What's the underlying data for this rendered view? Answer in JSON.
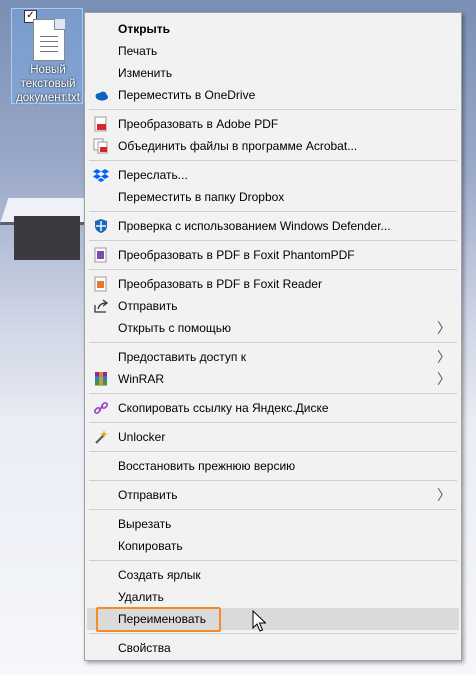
{
  "desktop": {
    "file_icon_label": "Новый текстовый документ.txt",
    "label_lines": [
      "Новый",
      "текстовый",
      "документ.txt"
    ]
  },
  "menu": {
    "items": [
      {
        "label": "Открыть",
        "bold": true
      },
      {
        "label": "Печать"
      },
      {
        "label": "Изменить"
      },
      {
        "label": "Переместить в OneDrive",
        "icon": "onedrive-icon"
      },
      {
        "label": "Преобразовать в Adobe PDF",
        "icon": "adobe-pdf-icon"
      },
      {
        "label": "Объединить файлы в программе Acrobat...",
        "icon": "acrobat-combine-icon"
      },
      {
        "label": "Переслать...",
        "icon": "dropbox-icon"
      },
      {
        "label": "Переместить в папку Dropbox"
      },
      {
        "label": "Проверка с использованием Windows Defender...",
        "icon": "windows-defender-icon"
      },
      {
        "label": "Преобразовать в PDF в Foxit PhantomPDF",
        "icon": "foxit-phantompdf-icon"
      },
      {
        "label": "Преобразовать в PDF в Foxit Reader",
        "icon": "foxit-reader-icon"
      },
      {
        "label": "Отправить",
        "icon": "share-icon"
      },
      {
        "label": "Открыть с помощью",
        "submenu": true
      },
      {
        "label": "Предоставить доступ к",
        "submenu": true
      },
      {
        "label": "WinRAR",
        "icon": "winrar-icon",
        "submenu": true
      },
      {
        "label": "Скопировать ссылку на Яндекс.Диске",
        "icon": "yandex-link-icon"
      },
      {
        "label": "Unlocker",
        "icon": "unlocker-wand-icon"
      },
      {
        "label": "Восстановить прежнюю версию"
      },
      {
        "label": "Отправить",
        "submenu": true
      },
      {
        "label": "Вырезать"
      },
      {
        "label": "Копировать"
      },
      {
        "label": "Создать ярлык"
      },
      {
        "label": "Удалить"
      },
      {
        "label": "Переименовать",
        "hovered": true
      },
      {
        "label": "Свойства"
      }
    ]
  },
  "colors": {
    "highlight_outline": "#f28c28",
    "menu_bg": "#f2f2f2",
    "hover_bg": "#dadada"
  }
}
